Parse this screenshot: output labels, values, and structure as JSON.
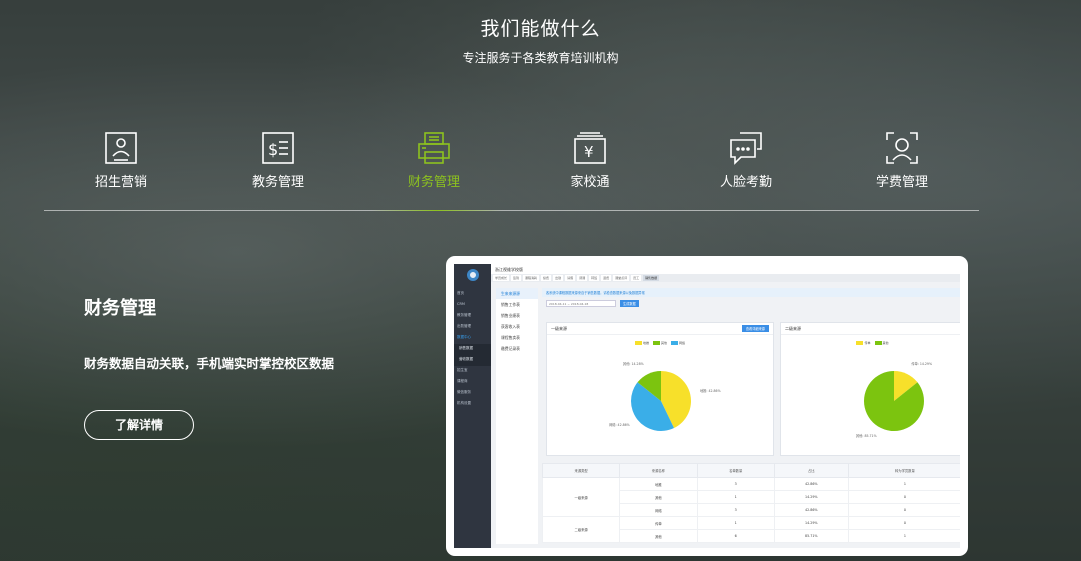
{
  "hero": {
    "title": "我们能做什么",
    "subtitle": "专注服务于各类教育培训机构"
  },
  "features": [
    {
      "label": "招生营销",
      "icon": "recruit-id-card-icon",
      "active": false
    },
    {
      "label": "教务管理",
      "icon": "document-icon",
      "active": false
    },
    {
      "label": "财务管理",
      "icon": "printer-icon",
      "active": true
    },
    {
      "label": "家校通",
      "icon": "yuan-screen-icon",
      "active": false
    },
    {
      "label": "人脸考勤",
      "icon": "chat-bubble-icon",
      "active": false
    },
    {
      "label": "学费管理",
      "icon": "face-scan-icon",
      "active": false
    }
  ],
  "colors": {
    "accent": "#8dc21f",
    "app_primary": "#3a8ee6"
  },
  "detail": {
    "title": "财务管理",
    "description": "财务数据自动关联，手机端实时掌控校区数据",
    "button": "了解详情"
  },
  "app": {
    "brand": "浙江视维学校版",
    "sidebar": [
      "首页",
      "CRM",
      "教务管理",
      "出勤管理",
      "数据中心",
      "销售数据",
      "营收数据",
      "招生宝",
      "课程商",
      "微信服务",
      "机构设置"
    ],
    "tabs": [
      "学员成长",
      "签到",
      "课程消耗",
      "续费",
      "出勤",
      "请假",
      "调课",
      "转班",
      "退费",
      "课堂点评",
      "员工",
      "销售数据"
    ],
    "submenu": [
      "生来来源源",
      "销售工作表",
      "销售业绩表",
      "获客收入表",
      "课程售卖表",
      "缴费记录表"
    ],
    "notice": "各系统中课程数据来源来自于销售数据，请检查数据来源以免数据异常",
    "date_range": "2018-04-11 ~ 2018-04-18",
    "query_button": "生成数据",
    "panel1_title": "一级来源",
    "panel1_button": "查看详细来源",
    "panel2_title": "二级来源"
  },
  "chart_data": [
    {
      "type": "pie",
      "title": "一级来源",
      "categories": [
        "地推",
        "网络",
        "其他"
      ],
      "values": [
        42.86,
        42.86,
        14.28
      ],
      "colors": [
        "#f7e02a",
        "#3aaee8",
        "#7cc40f"
      ]
    },
    {
      "type": "pie",
      "title": "二级来源",
      "categories": [
        "传单",
        "其他"
      ],
      "values": [
        14.29,
        85.71
      ],
      "colors": [
        "#f7e02a",
        "#7cc40f"
      ]
    }
  ],
  "table": {
    "headers": [
      "来源类型",
      "来源名称",
      "名单数量",
      "占比",
      "转为学员数量"
    ],
    "rows": [
      [
        "一级来源",
        "地推",
        "3",
        "42.86%",
        "1"
      ],
      [
        "",
        "其他",
        "1",
        "14.29%",
        "0"
      ],
      [
        "",
        "网络",
        "3",
        "42.86%",
        "0"
      ],
      [
        "二级来源",
        "传单",
        "1",
        "14.29%",
        "0"
      ],
      [
        "",
        "其他",
        "6",
        "85.71%",
        "1"
      ]
    ]
  }
}
